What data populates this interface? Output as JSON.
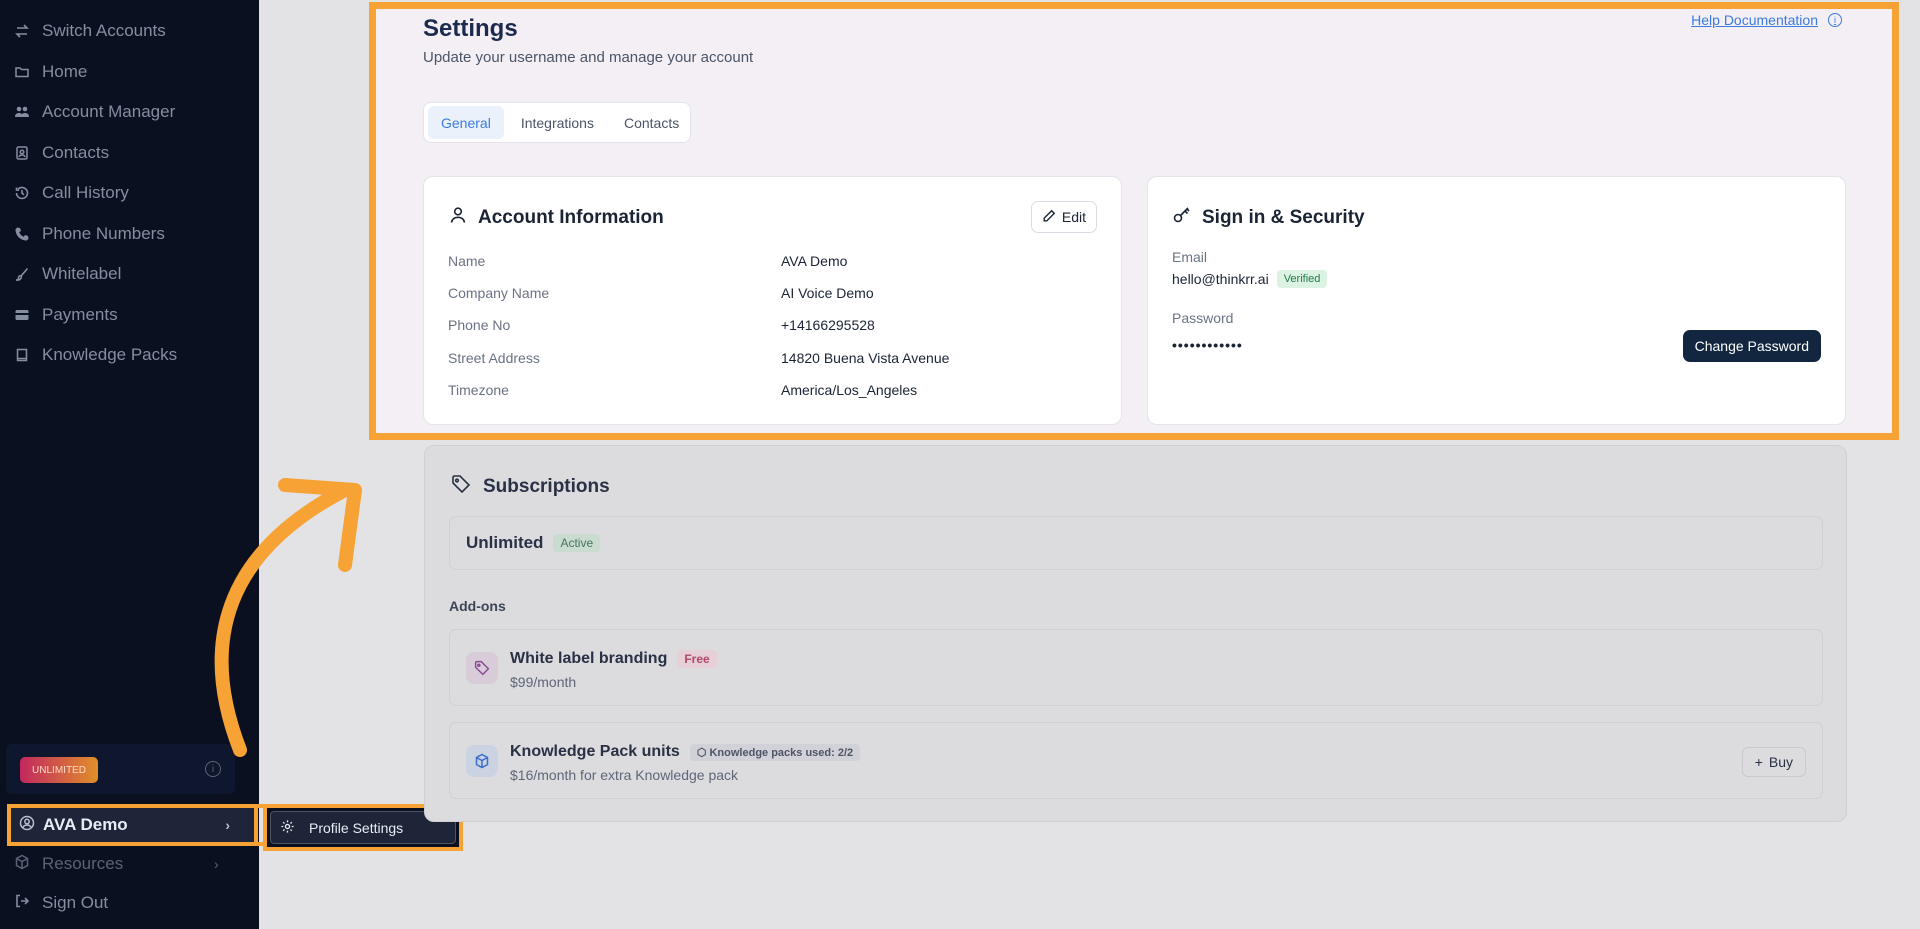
{
  "sidebar": {
    "items": [
      {
        "label": "Switch Accounts",
        "icon": "switch-icon"
      },
      {
        "label": "Home",
        "icon": "folder-icon"
      },
      {
        "label": "Account Manager",
        "icon": "users-icon"
      },
      {
        "label": "Contacts",
        "icon": "contact-card-icon"
      },
      {
        "label": "Call History",
        "icon": "history-icon"
      },
      {
        "label": "Phone Numbers",
        "icon": "phone-icon"
      },
      {
        "label": "Whitelabel",
        "icon": "brush-icon"
      },
      {
        "label": "Payments",
        "icon": "credit-card-icon"
      },
      {
        "label": "Knowledge Packs",
        "icon": "book-icon"
      }
    ],
    "plan_badge": "UNLIMITED",
    "user_name": "AVA Demo",
    "resources_label": "Resources",
    "signout_label": "Sign Out",
    "submenu": {
      "profile_settings": "Profile Settings"
    }
  },
  "settings": {
    "title": "Settings",
    "subtitle": "Update your username and manage your account",
    "help_link": "Help Documentation",
    "tabs": [
      {
        "label": "General",
        "active": true
      },
      {
        "label": "Integrations",
        "active": false
      },
      {
        "label": "Contacts",
        "active": false
      }
    ],
    "account": {
      "title": "Account Information",
      "edit_label": "Edit",
      "rows": [
        {
          "label": "Name",
          "value": "AVA Demo"
        },
        {
          "label": "Company Name",
          "value": "AI Voice Demo"
        },
        {
          "label": "Phone No",
          "value": "+14166295528"
        },
        {
          "label": "Street Address",
          "value": "14820 Buena Vista Avenue"
        },
        {
          "label": "Timezone",
          "value": "America/Los_Angeles"
        }
      ]
    },
    "security": {
      "title": "Sign in & Security",
      "email_label": "Email",
      "email_value": "hello@thinkrr.ai",
      "verified_badge": "Verified",
      "password_label": "Password",
      "password_value": "••••••••••••",
      "change_password_label": "Change Password"
    }
  },
  "subscriptions": {
    "title": "Subscriptions",
    "plan_name": "Unlimited",
    "plan_status": "Active",
    "addons_label": "Add-ons",
    "addons": [
      {
        "title": "White label branding",
        "badge": "Free",
        "price": "$99/month"
      },
      {
        "title": "Knowledge Pack units",
        "badge": "Knowledge packs used: 2/2",
        "price": "$16/month for extra Knowledge pack",
        "buy_label": "Buy"
      }
    ]
  },
  "colors": {
    "highlight": "#f7a234",
    "sidebar_bg": "#0b1020",
    "primary_button": "#12263f",
    "link": "#3b7be0"
  }
}
